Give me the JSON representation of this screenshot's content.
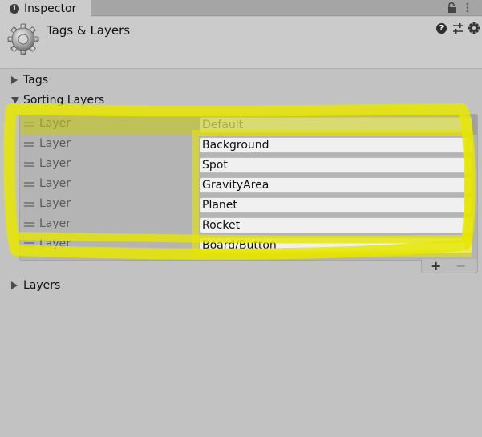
{
  "tab": {
    "label": "Inspector"
  },
  "header": {
    "title": "Tags & Layers"
  },
  "foldouts": {
    "tags": "Tags",
    "sorting_layers": "Sorting Layers",
    "layers": "Layers"
  },
  "sorting_layers": [
    {
      "label": "Layer",
      "value": "Default",
      "disabled": true
    },
    {
      "label": "Layer",
      "value": "Background"
    },
    {
      "label": "Layer",
      "value": "Spot"
    },
    {
      "label": "Layer",
      "value": "GravityArea"
    },
    {
      "label": "Layer",
      "value": "Planet"
    },
    {
      "label": "Layer",
      "value": "Rocket"
    },
    {
      "label": "Layer",
      "value": "Board/Button"
    }
  ],
  "list_controls": {
    "add": "+",
    "remove": "−"
  },
  "colors": {
    "highlight": "#e6e600",
    "panel": "#c2c2c2",
    "header": "#cbcbcb"
  }
}
